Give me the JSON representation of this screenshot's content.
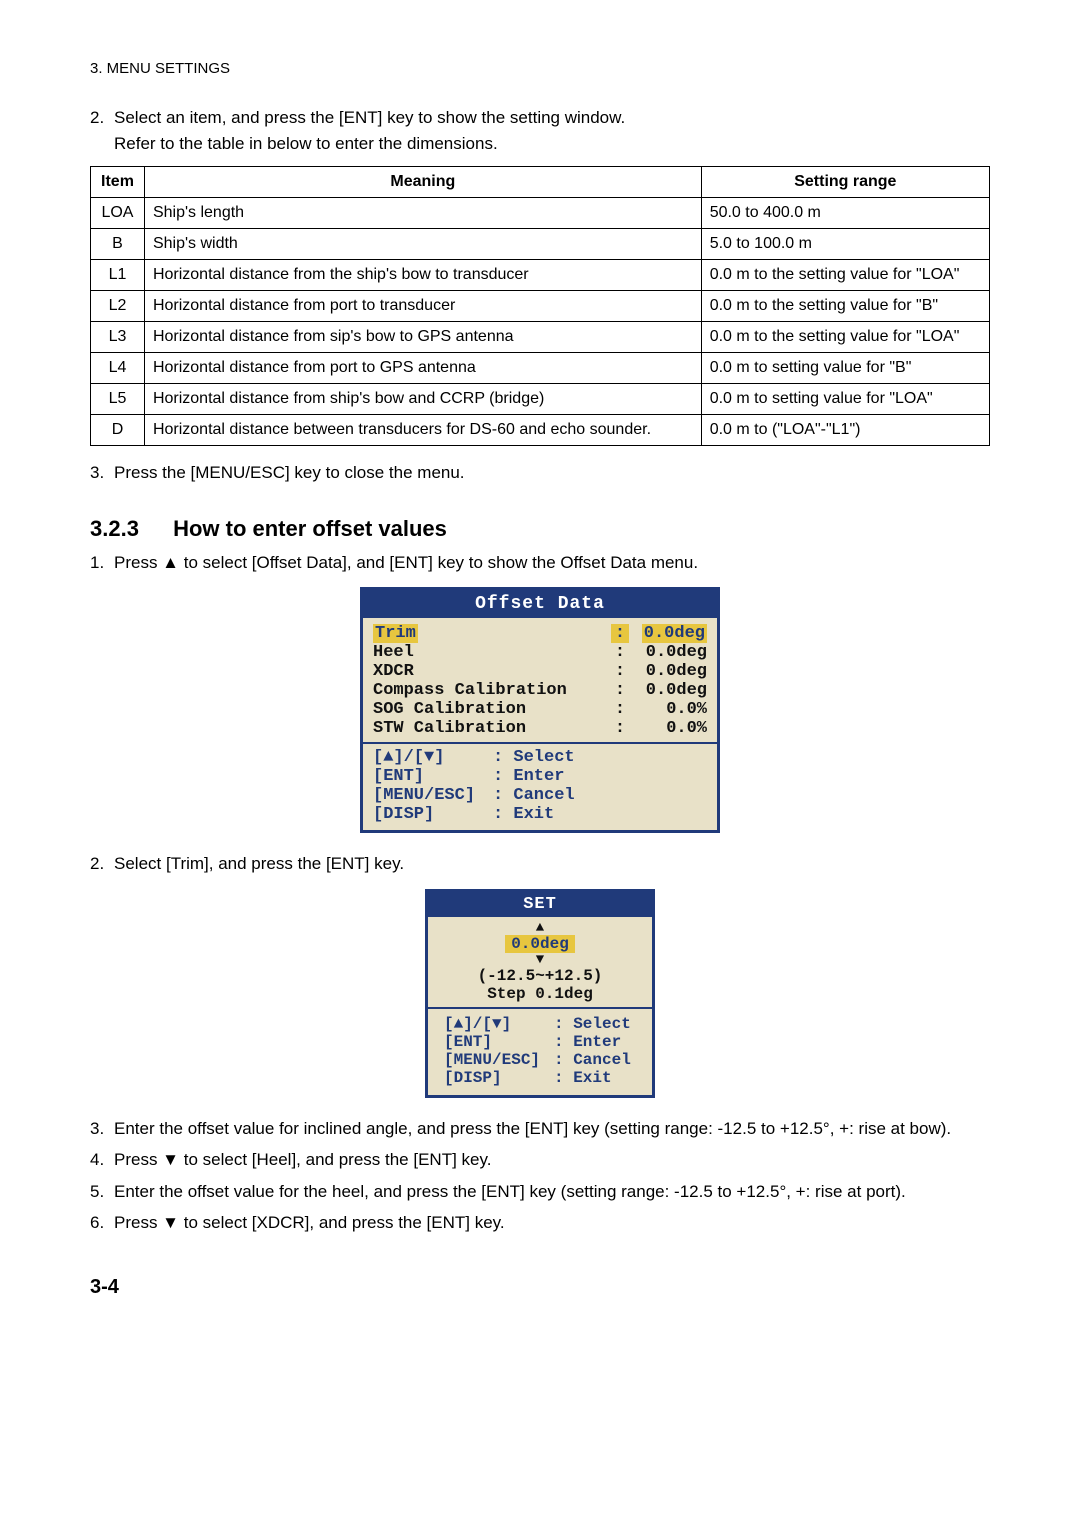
{
  "header": "3. MENU SETTINGS",
  "step2": {
    "num": "2.",
    "line1": "Select an item, and press the [ENT] key to show the setting window.",
    "line2": "Refer to the table in below to enter the dimensions."
  },
  "table": {
    "headers": {
      "item": "Item",
      "meaning": "Meaning",
      "range": "Setting range"
    },
    "rows": [
      {
        "item": "LOA",
        "meaning": "Ship's length",
        "range": "50.0 to 400.0 m"
      },
      {
        "item": "B",
        "meaning": "Ship's width",
        "range": "5.0 to 100.0 m"
      },
      {
        "item": "L1",
        "meaning": "Horizontal distance from the ship's bow to transducer",
        "range": "0.0 m to the setting value for \"LOA\""
      },
      {
        "item": "L2",
        "meaning": "Horizontal distance from port to transducer",
        "range": "0.0 m to the setting value for \"B\""
      },
      {
        "item": "L3",
        "meaning": "Horizontal distance from sip's bow to GPS antenna",
        "range": "0.0 m to the setting value for \"LOA\""
      },
      {
        "item": "L4",
        "meaning": "Horizontal distance from port to GPS antenna",
        "range": "0.0 m to setting value for \"B\""
      },
      {
        "item": "L5",
        "meaning": "Horizontal distance from ship's bow and CCRP (bridge)",
        "range": "0.0 m to setting value for \"LOA\""
      },
      {
        "item": "D",
        "meaning": "Horizontal distance between transducers for DS-60 and echo sounder.",
        "range": "0.0 m to (\"LOA\"-\"L1\")"
      }
    ]
  },
  "step3": {
    "num": "3.",
    "text": "Press the [MENU/ESC] key to close the menu."
  },
  "section": {
    "num": "3.2.3",
    "title": "How to enter offset values"
  },
  "steps_b": {
    "s1": {
      "num": "1.",
      "text": "Press ▲ to select [Offset Data], and [ENT] key to show the Offset Data menu."
    },
    "s2": {
      "num": "2.",
      "text": "Select [Trim], and press the [ENT] key."
    },
    "s3": {
      "num": "3.",
      "text": "Enter the offset value for inclined angle, and press the [ENT] key (setting range: -12.5 to +12.5°, +: rise at bow)."
    },
    "s4": {
      "num": "4.",
      "text": "Press ▼ to select [Heel], and press the [ENT] key."
    },
    "s5": {
      "num": "5.",
      "text": "Enter the offset value for the heel, and press the [ENT] key (setting range: -12.5 to +12.5°, +: rise at port)."
    },
    "s6": {
      "num": "6.",
      "text": "Press ▼ to select [XDCR], and press the [ENT] key."
    }
  },
  "offset_panel": {
    "title": "Offset Data",
    "rows": [
      {
        "label": "Trim",
        "value": "0.0deg",
        "hl": true
      },
      {
        "label": "Heel",
        "value": "0.0deg",
        "hl": false
      },
      {
        "label": "XDCR",
        "value": "0.0deg",
        "hl": false
      },
      {
        "label": "Compass Calibration",
        "value": "0.0deg",
        "hl": false
      },
      {
        "label": "SOG Calibration",
        "value": "0.0%",
        "hl": false
      },
      {
        "label": "STW Calibration",
        "value": "0.0%",
        "hl": false
      }
    ],
    "legend": {
      "l1k": "[▲]/[▼]",
      "l1v": ": Select",
      "l2k": "[ENT]",
      "l2v": ": Enter",
      "l3k": "[MENU/ESC]",
      "l3v": ": Cancel",
      "l4k": "[DISP]",
      "l4v": ": Exit"
    }
  },
  "set_panel": {
    "title": "SET",
    "up": "▲",
    "value": "0.0deg",
    "down": "▼",
    "range": "(-12.5~+12.5)",
    "step": "Step 0.1deg",
    "legend": {
      "l1k": "[▲]/[▼]",
      "l1v": ": Select",
      "l2k": "[ENT]",
      "l2v": ": Enter",
      "l3k": "[MENU/ESC]",
      "l3v": ": Cancel",
      "l4k": "[DISP]",
      "l4v": ": Exit"
    }
  },
  "page_number": "3-4"
}
